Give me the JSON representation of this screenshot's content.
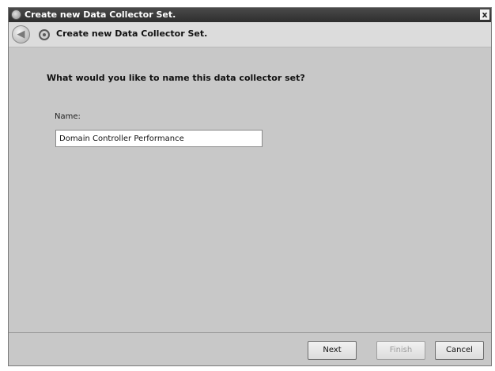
{
  "window": {
    "title": "Create new Data Collector Set.",
    "close_glyph": "x"
  },
  "header": {
    "back_glyph": "◀",
    "title": "Create new Data Collector Set."
  },
  "main": {
    "question": "What would you like to name this data collector set?",
    "name_label": "Name:",
    "name_value": "Domain Controller Performance"
  },
  "buttons": {
    "next": "Next",
    "finish": "Finish",
    "cancel": "Cancel"
  },
  "icons": [
    "window-icon",
    "back-arrow-icon",
    "wizard-icon"
  ]
}
